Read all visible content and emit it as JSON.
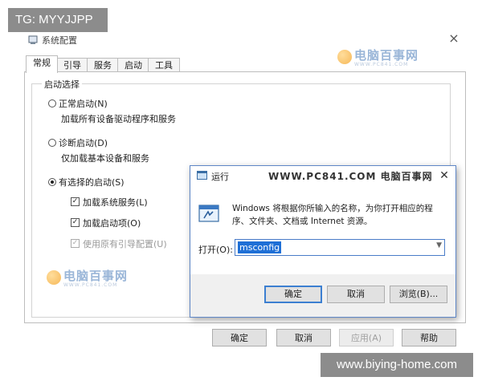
{
  "watermarks": {
    "top_left": "TG: MYYJJPP",
    "bottom_right": "www.biying-home.com",
    "logo_text": "电脑百事网",
    "logo_sub": "WWW.PC841.COM"
  },
  "sysconfig": {
    "title": "系统配置",
    "close_glyph": "×",
    "tabs": [
      "常规",
      "引导",
      "服务",
      "启动",
      "工具"
    ],
    "group_label": "启动选择",
    "options": [
      {
        "label": "正常启动(N)",
        "desc": "加载所有设备驱动程序和服务",
        "checked": false
      },
      {
        "label": "诊断启动(D)",
        "desc": "仅加载基本设备和服务",
        "checked": false
      },
      {
        "label": "有选择的启动(S)",
        "checked": true
      }
    ],
    "sub_options": [
      {
        "label": "加载系统服务(L)",
        "checked": true,
        "disabled": false
      },
      {
        "label": "加载启动项(O)",
        "checked": true,
        "disabled": false
      },
      {
        "label": "使用原有引导配置(U)",
        "checked": true,
        "disabled": true
      }
    ],
    "buttons": {
      "ok": "确定",
      "cancel": "取消",
      "apply": "应用(A)",
      "help": "帮助"
    }
  },
  "run": {
    "title": "运行",
    "watermark": "WWW.PC841.COM 电脑百事网",
    "close_glyph": "✕",
    "description": "Windows 将根据你所输入的名称，为你打开相应的程序、文件夹、文档或 Internet 资源。",
    "open_label": "打开(O):",
    "input_value": "msconfig",
    "buttons": {
      "ok": "确定",
      "cancel": "取消",
      "browse": "浏览(B)..."
    }
  }
}
